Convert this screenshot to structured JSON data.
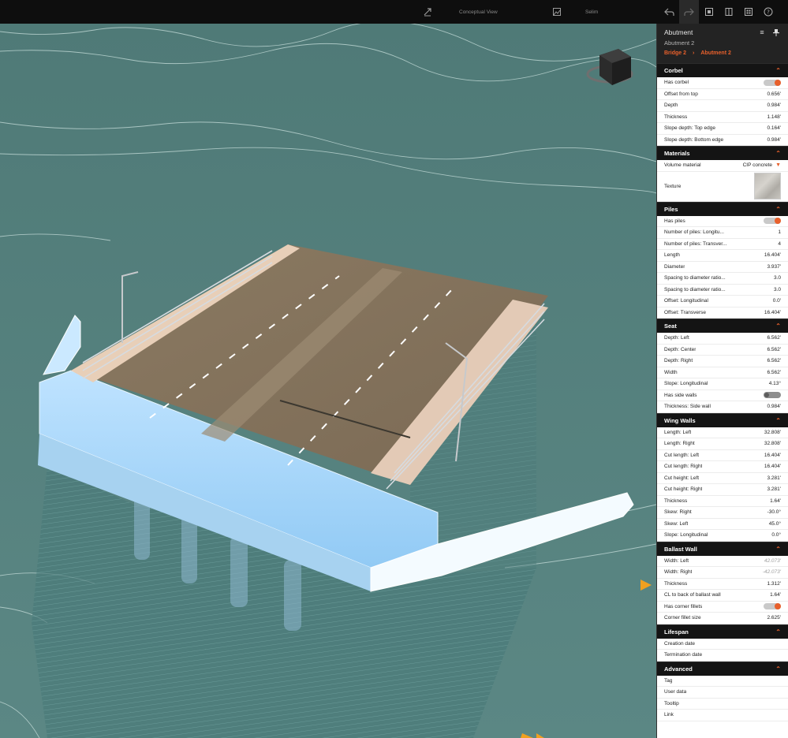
{
  "toolbar": {
    "view_mode": "Conceptual View",
    "select_label": "Selim",
    "icons": [
      "measure-icon",
      "image-icon",
      "undo-icon",
      "redo-icon",
      "layers-icon",
      "book-icon",
      "grid-icon",
      "help-icon"
    ]
  },
  "panel": {
    "title": "Abutment",
    "subtitle": "Abutment 2",
    "breadcrumb": [
      "Bridge 2",
      "Abutment 2"
    ],
    "sections": {
      "corbel": {
        "title": "Corbel",
        "rows": [
          {
            "label": "Has corbel",
            "value": "toggle:on"
          },
          {
            "label": "Offset from top",
            "value": "0.656'"
          },
          {
            "label": "Depth",
            "value": "0.984'"
          },
          {
            "label": "Thickness",
            "value": "1.148'"
          },
          {
            "label": "Slope depth: Top edge",
            "value": "0.164'"
          },
          {
            "label": "Slope depth: Bottom edge",
            "value": "0.984'"
          }
        ]
      },
      "materials": {
        "title": "Materials",
        "volume_label": "Volume material",
        "volume_value": "CIP concrete",
        "texture_label": "Texture"
      },
      "piles": {
        "title": "Piles",
        "rows": [
          {
            "label": "Has piles",
            "value": "toggle:on"
          },
          {
            "label": "Number of piles: Longitu...",
            "value": "1"
          },
          {
            "label": "Number of piles: Transver...",
            "value": "4"
          },
          {
            "label": "Length",
            "value": "16.404'"
          },
          {
            "label": "Diameter",
            "value": "3.937'"
          },
          {
            "label": "Spacing to diameter ratio...",
            "value": "3.0"
          },
          {
            "label": "Spacing to diameter ratio...",
            "value": "3.0"
          },
          {
            "label": "Offset: Longitudinal",
            "value": "0.0'"
          },
          {
            "label": "Offset: Transverse",
            "value": "16.404'"
          }
        ]
      },
      "seat": {
        "title": "Seat",
        "rows": [
          {
            "label": "Depth: Left",
            "value": "6.562'"
          },
          {
            "label": "Depth: Center",
            "value": "6.562'"
          },
          {
            "label": "Depth: Right",
            "value": "6.562'"
          },
          {
            "label": "Width",
            "value": "6.562'"
          },
          {
            "label": "Slope: Longitudinal",
            "value": "4.13°"
          },
          {
            "label": "Has side walls",
            "value": "toggle:off"
          },
          {
            "label": "Thickness: Side wall",
            "value": "0.984'"
          }
        ]
      },
      "wing_walls": {
        "title": "Wing Walls",
        "rows": [
          {
            "label": "Length: Left",
            "value": "32.808'"
          },
          {
            "label": "Length: Right",
            "value": "32.808'"
          },
          {
            "label": "Cut length: Left",
            "value": "16.404'"
          },
          {
            "label": "Cut length: Right",
            "value": "16.404'"
          },
          {
            "label": "Cut height: Left",
            "value": "3.281'"
          },
          {
            "label": "Cut height: Right",
            "value": "3.281'"
          },
          {
            "label": "Thickness",
            "value": "1.64'"
          },
          {
            "label": "Skew: Right",
            "value": "-30.0°"
          },
          {
            "label": "Skew: Left",
            "value": "45.0°"
          },
          {
            "label": "Slope: Longitudinal",
            "value": "0.0°"
          }
        ]
      },
      "ballast_wall": {
        "title": "Ballast Wall",
        "rows": [
          {
            "label": "Width: Left",
            "value": "42.073'",
            "muted": true
          },
          {
            "label": "Width: Right",
            "value": "-42.073'",
            "muted": true
          },
          {
            "label": "Thickness",
            "value": "1.312'"
          },
          {
            "label": "CL to back of ballast wall",
            "value": "1.64'"
          },
          {
            "label": "Has corner fillets",
            "value": "toggle:on"
          },
          {
            "label": "Corner fillet size",
            "value": "2.625'"
          }
        ]
      },
      "lifespan": {
        "title": "Lifespan",
        "rows": [
          {
            "label": "Creation date",
            "value": ""
          },
          {
            "label": "Termination date",
            "value": ""
          }
        ]
      },
      "advanced": {
        "title": "Advanced",
        "rows": [
          {
            "label": "Tag",
            "value": ""
          },
          {
            "label": "User data",
            "value": ""
          },
          {
            "label": "Tooltip",
            "value": ""
          },
          {
            "label": "Link",
            "value": ""
          }
        ]
      }
    }
  },
  "colors": {
    "accent": "#e8602c",
    "water": "#547f7c",
    "panel_header": "#141414"
  }
}
